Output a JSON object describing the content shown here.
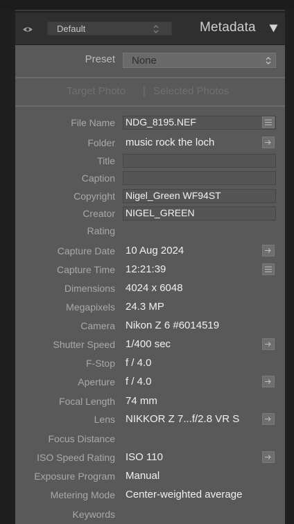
{
  "header": {
    "preset_dropdown": "Default",
    "title": "Metadata"
  },
  "preset": {
    "label": "Preset",
    "value": "None"
  },
  "target": {
    "target_photo": "Target Photo",
    "separator": "|",
    "selected_photos": "Selected Photos"
  },
  "fields": {
    "file_name": {
      "label": "File Name",
      "value": "NDG_8195.NEF"
    },
    "folder": {
      "label": "Folder",
      "value": "music rock the loch"
    },
    "title": {
      "label": "Title",
      "value": ""
    },
    "caption": {
      "label": "Caption",
      "value": ""
    },
    "copyright": {
      "label": "Copyright",
      "value": "Nigel_Green WF94ST"
    },
    "creator": {
      "label": "Creator",
      "value": "NIGEL_GREEN"
    },
    "rating": {
      "label": "Rating",
      "value": ""
    },
    "capture_date": {
      "label": "Capture Date",
      "value": "10 Aug 2024"
    },
    "capture_time": {
      "label": "Capture Time",
      "value": "12:21:39"
    },
    "dimensions": {
      "label": "Dimensions",
      "value": "4024 x 6048"
    },
    "megapixels": {
      "label": "Megapixels",
      "value": "24.3 MP"
    },
    "camera": {
      "label": "Camera",
      "value": "Nikon Z 6 #6014519"
    },
    "shutter_speed": {
      "label": "Shutter Speed",
      "value": "1/400 sec"
    },
    "f_stop": {
      "label": "F-Stop",
      "value": "f / 4.0"
    },
    "aperture": {
      "label": "Aperture",
      "value": "f / 4.0"
    },
    "focal_length": {
      "label": "Focal Length",
      "value": "74 mm"
    },
    "lens": {
      "label": "Lens",
      "value": "NIKKOR Z 7...f/2.8 VR S"
    },
    "focus_distance": {
      "label": "Focus Distance",
      "value": ""
    },
    "iso": {
      "label": "ISO Speed Rating",
      "value": "ISO 110"
    },
    "exposure_program": {
      "label": "Exposure Program",
      "value": "Manual"
    },
    "metering_mode": {
      "label": "Metering Mode",
      "value": "Center-weighted average"
    },
    "keywords": {
      "label": "Keywords",
      "value": ""
    }
  },
  "icons": {
    "visibility": "eye-icon",
    "collapse": "triangle-down-icon",
    "list_action": "list-icon",
    "go_action": "arrow-right-icon"
  },
  "colors": {
    "panel_bg": "#595959",
    "header_bg": "#2f2f2f",
    "value_text": "#f0f0f0",
    "label_text": "#a9a9a9"
  }
}
